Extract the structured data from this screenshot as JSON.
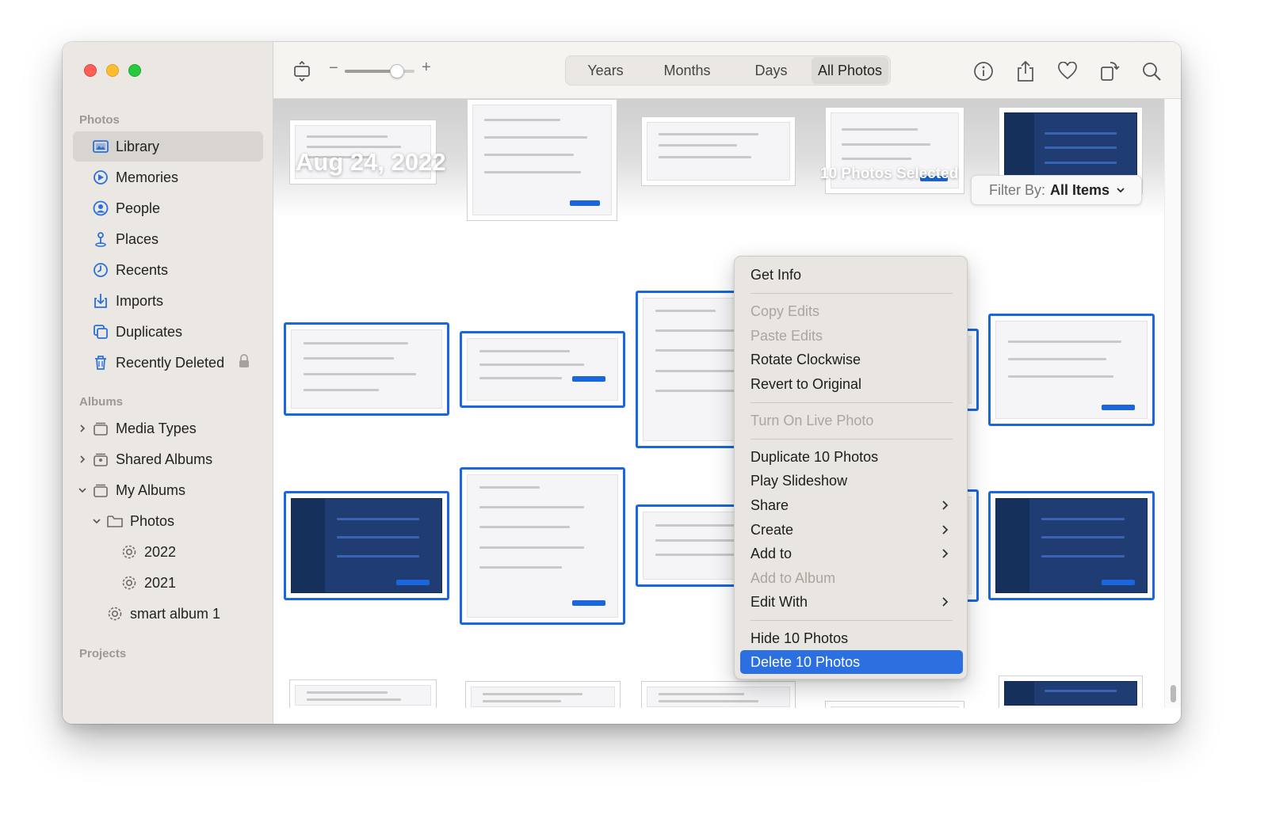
{
  "window": {
    "traffic_lights": [
      "close",
      "minimize",
      "zoom"
    ]
  },
  "sidebar": {
    "section_photos": "Photos",
    "library_items": [
      {
        "label": "Library",
        "icon": "library-icon"
      },
      {
        "label": "Memories",
        "icon": "memories-icon"
      },
      {
        "label": "People",
        "icon": "people-icon"
      },
      {
        "label": "Places",
        "icon": "places-icon"
      },
      {
        "label": "Recents",
        "icon": "recents-icon"
      },
      {
        "label": "Imports",
        "icon": "imports-icon"
      },
      {
        "label": "Duplicates",
        "icon": "duplicates-icon"
      },
      {
        "label": "Recently Deleted",
        "icon": "trash-icon",
        "locked": true
      }
    ],
    "section_albums": "Albums",
    "album_items": [
      {
        "label": "Media Types",
        "expanded": false
      },
      {
        "label": "Shared Albums",
        "expanded": false
      },
      {
        "label": "My Albums",
        "expanded": true
      },
      {
        "label": "Photos",
        "expanded": true
      },
      {
        "label": "2022"
      },
      {
        "label": "2021"
      },
      {
        "label": "smart album 1"
      }
    ],
    "section_projects": "Projects"
  },
  "toolbar": {
    "zoom_minus": "−",
    "zoom_plus": "+",
    "zoom_level": 0.75,
    "views": [
      "Years",
      "Months",
      "Days",
      "All Photos"
    ],
    "active_view": "All Photos",
    "right_icons": [
      "info-icon",
      "share-icon",
      "heart-icon",
      "rotate-icon",
      "search-icon"
    ]
  },
  "grid": {
    "date_heading": "Aug 24, 2022",
    "selection_label": "10 Photos Selected",
    "filter_prefix": "Filter By:",
    "filter_value": "All Items"
  },
  "context_menu": {
    "groups": [
      [
        {
          "label": "Get Info",
          "enabled": true
        }
      ],
      [
        {
          "label": "Copy Edits",
          "enabled": false
        },
        {
          "label": "Paste Edits",
          "enabled": false
        },
        {
          "label": "Rotate Clockwise",
          "enabled": true
        },
        {
          "label": "Revert to Original",
          "enabled": true
        }
      ],
      [
        {
          "label": "Turn On Live Photo",
          "enabled": false
        }
      ],
      [
        {
          "label": "Duplicate 10 Photos",
          "enabled": true
        },
        {
          "label": "Play Slideshow",
          "enabled": true
        },
        {
          "label": "Share",
          "enabled": true,
          "submenu": true
        },
        {
          "label": "Create",
          "enabled": true,
          "submenu": true
        },
        {
          "label": "Add to",
          "enabled": true,
          "submenu": true
        },
        {
          "label": "Add to Album",
          "enabled": false
        },
        {
          "label": "Edit With",
          "enabled": true,
          "submenu": true
        }
      ],
      [
        {
          "label": "Hide 10 Photos",
          "enabled": true
        },
        {
          "label": "Delete 10 Photos",
          "enabled": true,
          "highlighted": true
        }
      ]
    ]
  },
  "colors": {
    "selection": "#1a66dc",
    "menu_highlight": "#2b6fe0",
    "sidebar_bg": "#ebe7e2"
  }
}
